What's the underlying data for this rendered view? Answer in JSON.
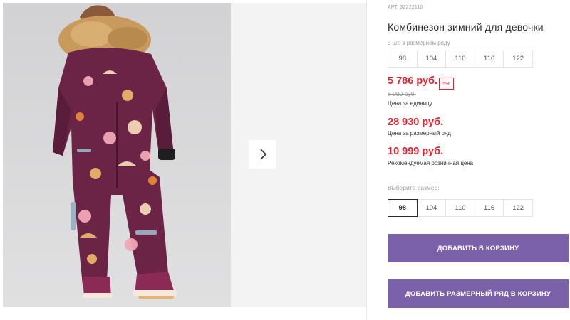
{
  "gallery": {
    "photo_alt": "child in winter suit",
    "next_icon": "chevron-right-icon"
  },
  "product": {
    "sku": "АРТ. 32222110",
    "title": "Комбинезон зимний для девочки",
    "pack_note": "5 шт. в размерном ряду",
    "pack_sizes": [
      "98",
      "104",
      "110",
      "116",
      "122"
    ],
    "price_unit": "5 786 руб.",
    "discount": "5%",
    "old_price": "6 090 руб.",
    "price_unit_caption": "Цена за единицу",
    "price_pack": "28 930 руб.",
    "price_pack_caption": "Цена за размерный ряд",
    "price_retail": "10 999 руб.",
    "price_retail_caption": "Рекомендуемая розничная цена",
    "select_size_label": "Выберите размер:",
    "select_sizes": [
      "98",
      "104",
      "110",
      "116",
      "122"
    ],
    "selected_size": "98"
  },
  "actions": {
    "add_to_cart": "ДОБАВИТЬ В КОРЗИНУ",
    "add_pack_to_cart": "ДОБАВИТЬ РАЗМЕРНЫЙ РЯД В КОРЗИНУ"
  },
  "colors": {
    "price_red": "#e4232f",
    "button_purple": "#7b62a8",
    "suit_purple": "#6b2346",
    "fur": "#c99a5d"
  }
}
